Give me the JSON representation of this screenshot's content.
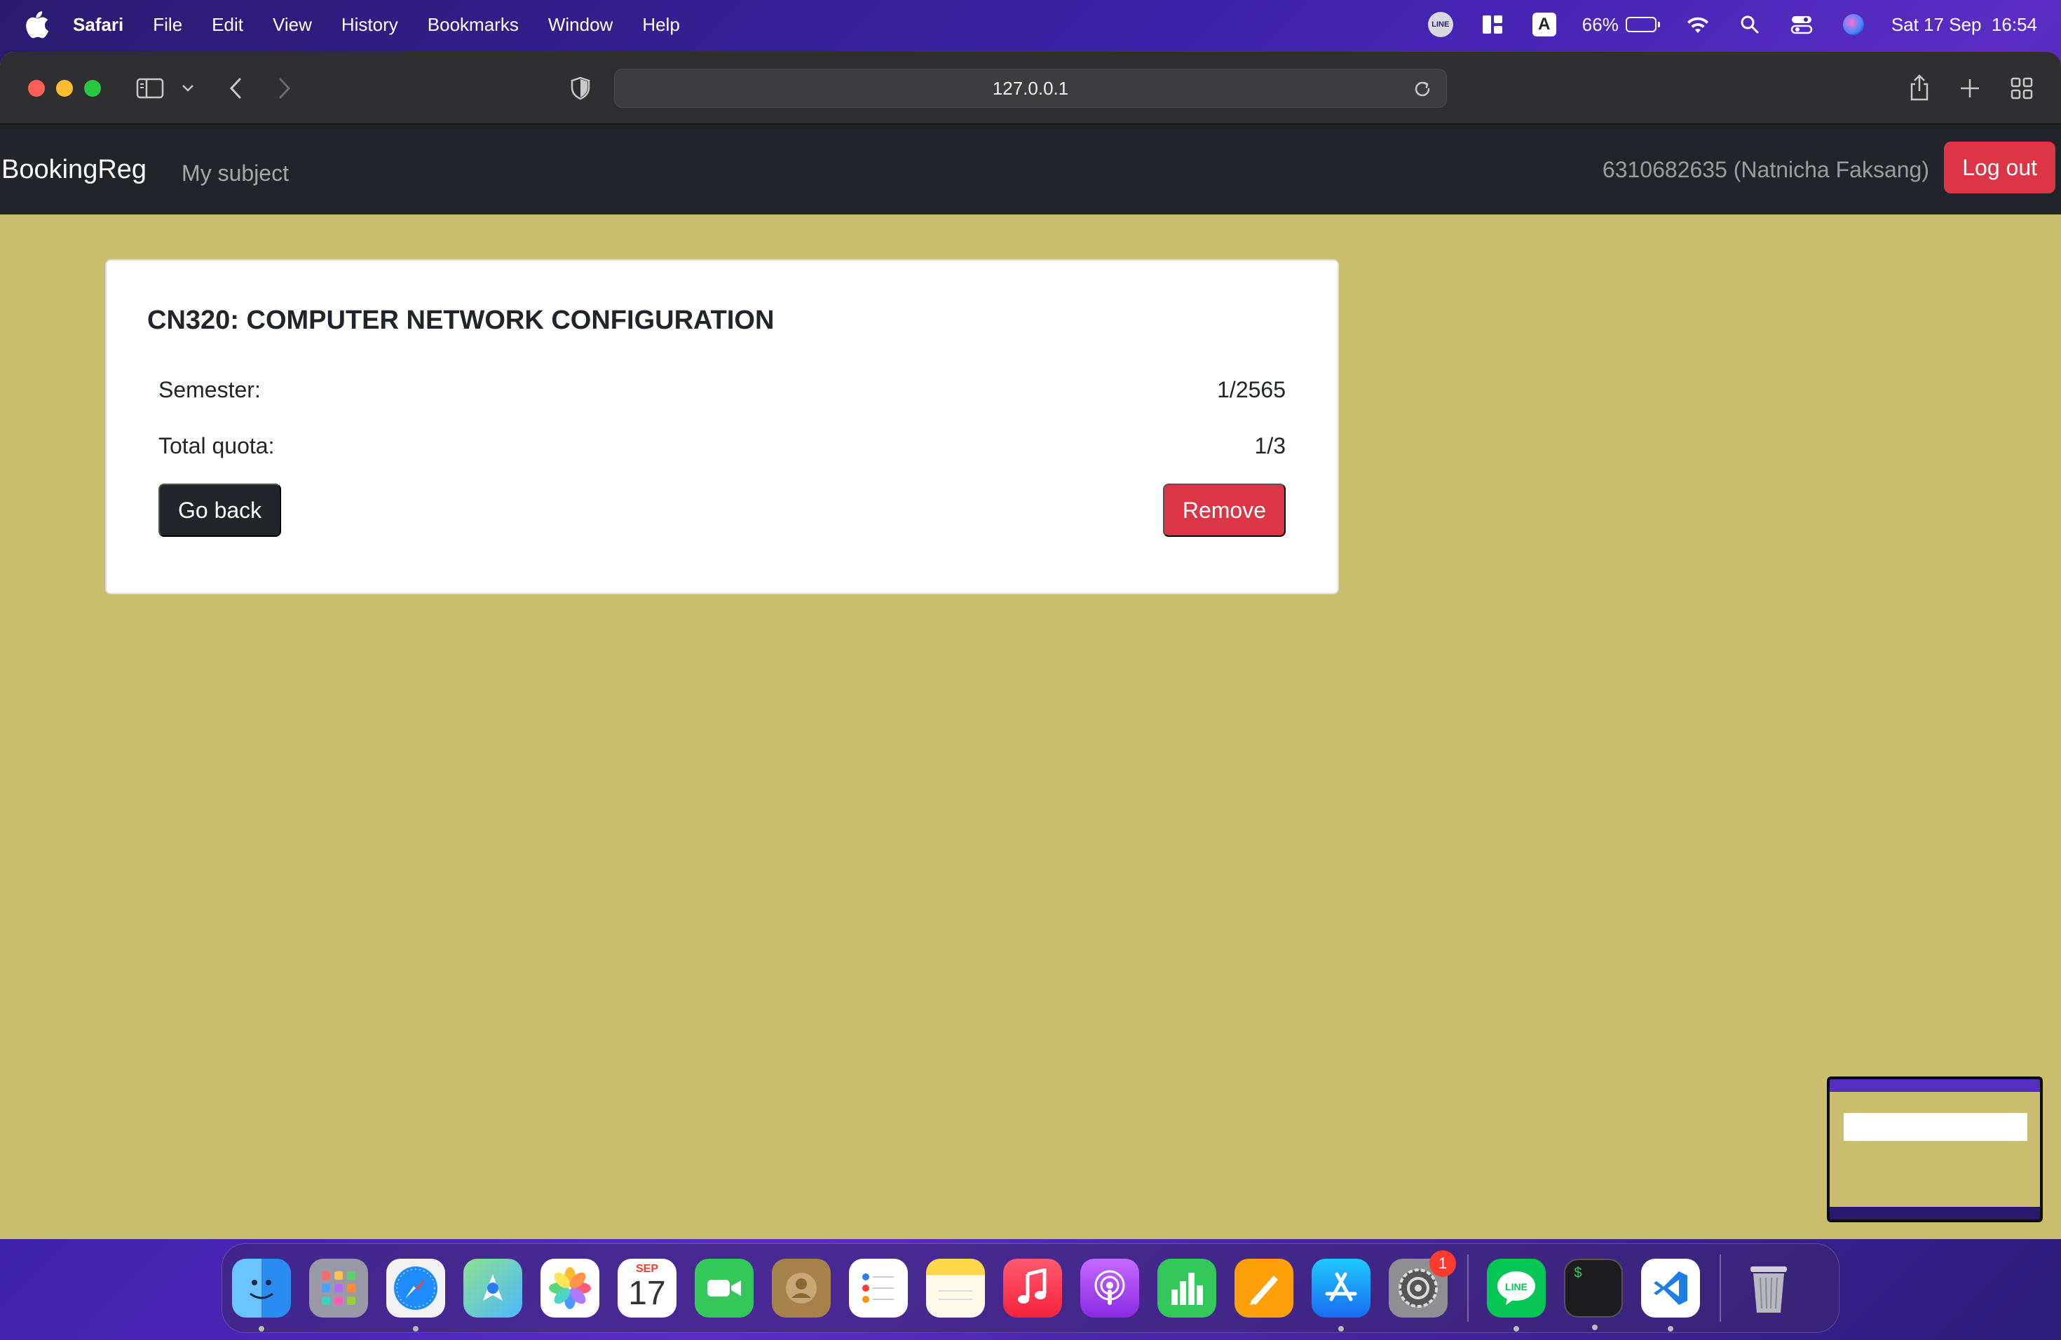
{
  "menubar": {
    "app_name": "Safari",
    "menus": [
      "File",
      "Edit",
      "View",
      "History",
      "Bookmarks",
      "Window",
      "Help"
    ],
    "line_label": "LINE",
    "input_source": "A",
    "battery_percent": "66%",
    "battery_level": 0.66,
    "datetime": "Sat 17 Sep  16:54"
  },
  "browser": {
    "url": "127.0.0.1"
  },
  "navbar": {
    "brand": "BookingReg",
    "link_my_subject": "My subject",
    "user": "6310682635 (Natnicha Faksang)",
    "logout_label": "Log out"
  },
  "subject": {
    "title": "CN320: COMPUTER NETWORK CONFIGURATION",
    "semester_label": "Semester:",
    "semester_value": "1/2565",
    "quota_label": "Total quota:",
    "quota_value": "1/3",
    "back_label": "Go back",
    "remove_label": "Remove"
  },
  "colors": {
    "page_background": "#c8be6e",
    "navbar": "#212529",
    "danger": "#dc3545",
    "dark_button": "#212529"
  },
  "dock": {
    "apps": [
      "finder",
      "launchpad",
      "safari",
      "maps",
      "photos",
      "calendar",
      "facetime",
      "contacts",
      "reminders",
      "notes",
      "music",
      "podcasts",
      "numbers",
      "pages",
      "app-store",
      "system-preferences",
      "line",
      "terminal",
      "vscode",
      "trash"
    ],
    "calendar_month": "SEP",
    "calendar_day": "17",
    "settings_badge": "1",
    "line_label": "LINE",
    "terminal_prompt": "$"
  }
}
